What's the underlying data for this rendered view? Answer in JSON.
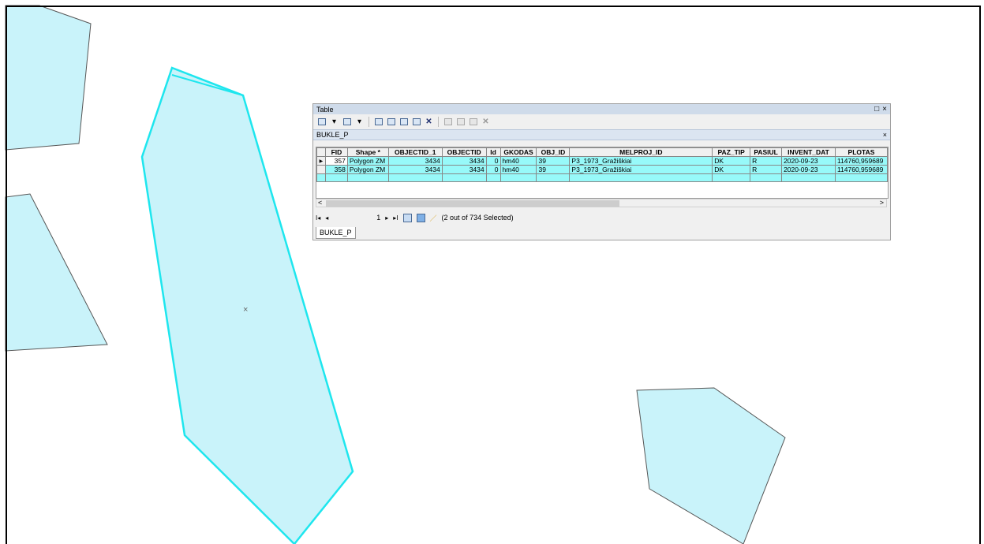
{
  "colors": {
    "polygon_fill": "#c9f3fa",
    "polygon_stroke": "#555555",
    "selected_stroke": "#1ee6ee",
    "cell_selected": "#97f9f9"
  },
  "window": {
    "title": "Table",
    "restore_icon": "restore-icon",
    "close_label": "×",
    "tab_title": "BUKLE_P",
    "tab_close_label": "×",
    "toolbar_icons": [
      "table-options-icon",
      "related-tables-icon",
      "select-by-attributes-icon",
      "switch-selection-icon",
      "clear-selection-icon",
      "zoom-to-selected-icon",
      "delete-selected-icon",
      "copy-icon",
      "paste-icon",
      "zoom-icon",
      "delete-icon"
    ]
  },
  "table": {
    "columns": [
      "FID",
      "Shape *",
      "OBJECTID_1",
      "OBJECTID",
      "Id",
      "GKODAS",
      "OBJ_ID",
      "MELPROJ_ID",
      "PAZ_TIP",
      "PASIUL",
      "INVENT_DAT",
      "PLOTAS"
    ],
    "rows": [
      {
        "cells": [
          "357",
          "Polygon ZM",
          "3434",
          "3434",
          "0",
          "hm40",
          "39",
          "P3_1973_Gražiškiai",
          "DK",
          "R",
          "2020-09-23",
          "114760,959689"
        ],
        "current": true
      },
      {
        "cells": [
          "358",
          "Polygon ZM",
          "3434",
          "3434",
          "0",
          "hm40",
          "39",
          "P3_1973_Gražiškiai",
          "DK",
          "R",
          "2020-09-23",
          "114760,959689"
        ],
        "current": false
      }
    ]
  },
  "nav": {
    "first_label": "I◂",
    "prev_label": "◂",
    "record_number": "1",
    "next_label": "▸",
    "last_label": "▸I",
    "selection_text": "(2 out of 734 Selected)"
  },
  "bottom_tab": "BUKLE_P",
  "scroll_left": "<",
  "scroll_right": ">"
}
